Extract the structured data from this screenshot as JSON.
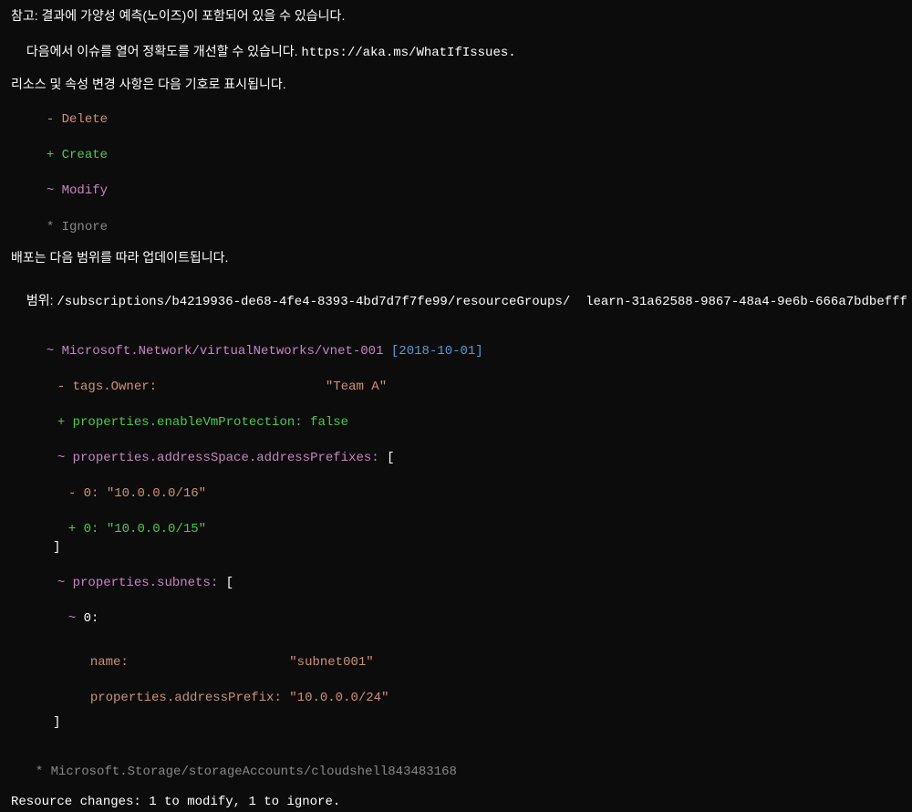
{
  "header": {
    "note_line": "참고: 결과에 가양성 예측(노이즈)이 포함되어 있을 수 있습니다.",
    "issue_prefix": "다음에서 이슈를 열어 정확도를 개선할 수 있습니다. ",
    "issue_url": "https://aka.ms/WhatIfIssues",
    "issue_suffix": "."
  },
  "legend": {
    "title": "리소스 및 속성 변경 사항은 다음 기호로 표시됩니다.",
    "delete_symbol": "-",
    "delete_label": "Delete",
    "create_symbol": "+",
    "create_label": "Create",
    "modify_symbol": "~",
    "modify_label": "Modify",
    "ignore_symbol": "*",
    "ignore_label": "Ignore"
  },
  "scope": {
    "update_line": "배포는 다음 범위를 따라 업데이트됩니다.",
    "scope_prefix": "범위: ",
    "scope_path": "/subscriptions/b4219936-de68-4fe4-8393-4bd7d7f7fe99/resourceGroups/",
    "scope_group": "learn-31a62588-9867-48a4-9e6b-666a7bdbefff"
  },
  "resource": {
    "modify_symbol": "~",
    "resource_path": "Microsoft.Network/virtualNetworks/vnet-001",
    "api_version": "[2018-10-01]",
    "tags_owner_key": "tags.Owner:",
    "tags_owner_value": "\"Team A\"",
    "enable_vm_key": "properties.enableVmProtection:",
    "enable_vm_value": "false",
    "addr_prefixes_key": "properties.addressSpace.addressPrefixes:",
    "bracket_open": "[",
    "bracket_close": "]",
    "zero_key": "0:",
    "addr_old": "\"10.0.0.0/16\"",
    "addr_new": "\"10.0.0.0/15\"",
    "subnets_key": "properties.subnets:",
    "dash_symbol": "-",
    "plus_symbol": "+",
    "tilde_symbol": "~",
    "subnet_name_key": "name:",
    "subnet_name_value": "\"subnet001\"",
    "subnet_prefix_key": "properties.addressPrefix:",
    "subnet_prefix_value": "\"10.0.0.0/24\""
  },
  "ignored": {
    "star": "*",
    "path": "Microsoft.Storage/storageAccounts/cloudshell843483168"
  },
  "summary": {
    "text": "Resource changes: 1 to modify, 1 to ignore."
  }
}
